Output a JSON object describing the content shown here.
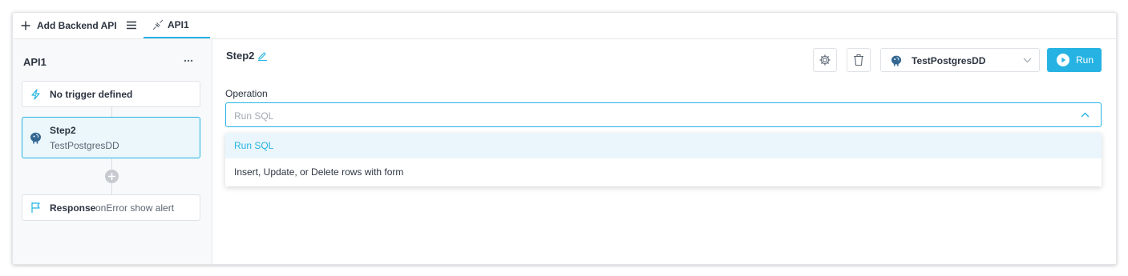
{
  "tabs": {
    "add_label": "Add Backend API",
    "active_tab_label": "API1",
    "accent_color": "#26b3e3"
  },
  "sidebar": {
    "title": "API1",
    "trigger": {
      "label": "No trigger defined",
      "icon": "lightning-icon"
    },
    "step": {
      "name": "Step2",
      "datasource": "TestPostgresDD",
      "icon": "postgres-icon"
    },
    "response": {
      "label": "Response",
      "detail": "onError show alert",
      "icon": "flag-icon"
    }
  },
  "main": {
    "step_title": "Step2",
    "datasource": "TestPostgresDD",
    "run_label": "Run",
    "operation_label": "Operation",
    "operation_value": "Run SQL",
    "options": [
      "Run SQL",
      "Insert, Update, or Delete rows with form"
    ],
    "selected_option_index": 0
  }
}
